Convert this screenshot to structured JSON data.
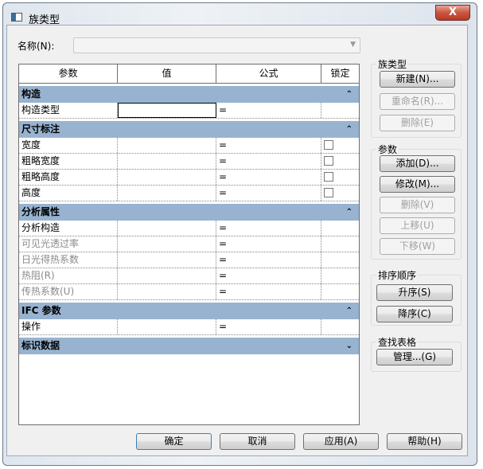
{
  "window": {
    "title": "族类型",
    "close": "X"
  },
  "name_label": "名称(N):",
  "name_value": "",
  "columns": [
    "参数",
    "值",
    "公式",
    "锁定"
  ],
  "sections": [
    {
      "title": "构造",
      "toggle": "⌃",
      "rows": [
        {
          "name": "构造类型",
          "value": "",
          "formula": "=",
          "lock": false,
          "editing": true
        }
      ]
    },
    {
      "title": "尺寸标注",
      "toggle": "⌃",
      "rows": [
        {
          "name": "宽度",
          "formula": "=",
          "lock": true
        },
        {
          "name": "粗略宽度",
          "formula": "=",
          "lock": true
        },
        {
          "name": "粗略高度",
          "formula": "=",
          "lock": true
        },
        {
          "name": "高度",
          "formula": "=",
          "lock": true
        }
      ]
    },
    {
      "title": "分析属性",
      "toggle": "⌃",
      "rows": [
        {
          "name": "分析构造",
          "formula": "="
        },
        {
          "name": "可见光透过率",
          "formula": "=",
          "grey": true
        },
        {
          "name": "日光得热系数",
          "formula": "=",
          "grey": true
        },
        {
          "name": "热阻(R)",
          "formula": "=",
          "grey": true
        },
        {
          "name": "传热系数(U)",
          "formula": "=",
          "grey": true
        }
      ]
    },
    {
      "title": "IFC 参数",
      "toggle": "⌃",
      "rows": [
        {
          "name": "操作",
          "formula": "="
        }
      ]
    },
    {
      "title": "标识数据",
      "toggle": "⌄",
      "rows": []
    }
  ],
  "family_types": {
    "label": "族类型",
    "new": "新建(N)...",
    "rename": "重命名(R)...",
    "delete": "删除(E)"
  },
  "parameters": {
    "label": "参数",
    "add": "添加(D)...",
    "modify": "修改(M)...",
    "delete": "删除(V)",
    "up": "上移(U)",
    "down": "下移(W)"
  },
  "sort": {
    "label": "排序顺序",
    "asc": "升序(S)",
    "desc": "降序(C)"
  },
  "lookup": {
    "label": "查找表格",
    "manage": "管理...(G)"
  },
  "footer": {
    "ok": "确定",
    "cancel": "取消",
    "apply": "应用(A)",
    "help": "帮助(H)"
  }
}
